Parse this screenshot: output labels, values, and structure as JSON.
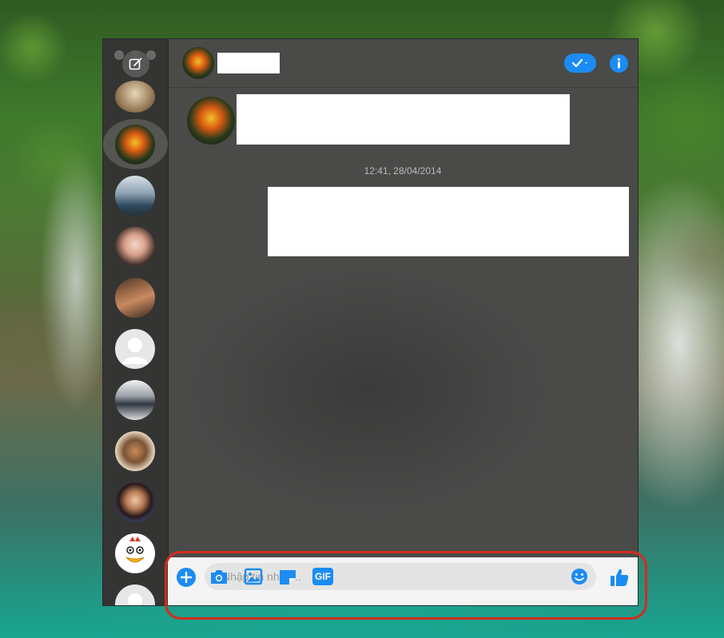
{
  "chat": {
    "timestamp": "12:41, 28/04/2014"
  },
  "composer": {
    "placeholder": "Nhập tin nhắn...",
    "gif_label": "GIF"
  },
  "colors": {
    "accent": "#1b8cf3",
    "highlight": "#d42b1e"
  },
  "icons": {
    "compose": "compose-icon",
    "delivered": "check-icon",
    "info": "info-icon",
    "plus": "plus-icon",
    "camera": "camera-icon",
    "photo": "photo-icon",
    "sticker": "sticker-icon",
    "gif": "gif-icon",
    "emoji": "emoji-icon",
    "like": "thumbs-up-icon"
  }
}
